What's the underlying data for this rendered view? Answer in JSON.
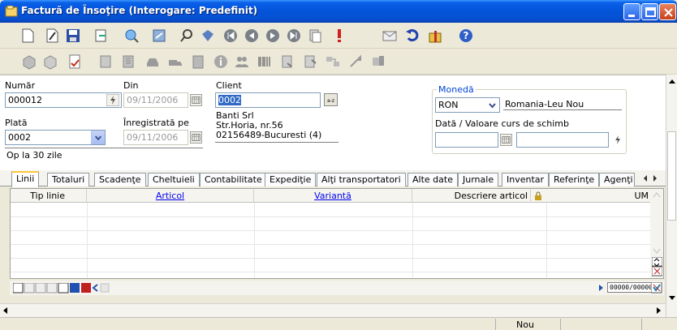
{
  "window": {
    "title": "Factură de Însoţire (Interogare: Predefinit)"
  },
  "form": {
    "numar": {
      "label": "Număr",
      "value": "000012"
    },
    "din": {
      "label": "Din",
      "value": "09/11/2006"
    },
    "client": {
      "label": "Client",
      "value": "0002",
      "name": "Banti Srl",
      "address1": "Str.Horia, nr.56",
      "address2": "02156489-Bucuresti (4)"
    },
    "plata": {
      "label": "Plată",
      "value": "0002",
      "description": "Op la 30 zile"
    },
    "inregistrata": {
      "label": "Înregistrată pe",
      "value": "09/11/2006"
    },
    "moneda": {
      "label": "Monedă",
      "code": "RON",
      "name": "Romania-Leu Nou"
    },
    "curs": {
      "label": "Dată / Valoare curs de schimb"
    }
  },
  "tabs": [
    "Linii",
    "Totaluri",
    "Scadenţe",
    "Cheltuieli",
    "Contabilitate",
    "Expediţie",
    "Alţi transportatori",
    "Alte date",
    "Jurnale",
    "Inventar",
    "Referinţe",
    "Agenţi"
  ],
  "grid": {
    "columns": [
      "Tip linie",
      "Articol",
      "Variantă",
      "Descriere articol",
      "UM"
    ]
  },
  "pager": "00000/00000",
  "status": {
    "mode": "Nou"
  },
  "colors": {
    "title_blue": "#0354DA",
    "accent_tab": "#FFC83C",
    "link": "#0000EE"
  }
}
